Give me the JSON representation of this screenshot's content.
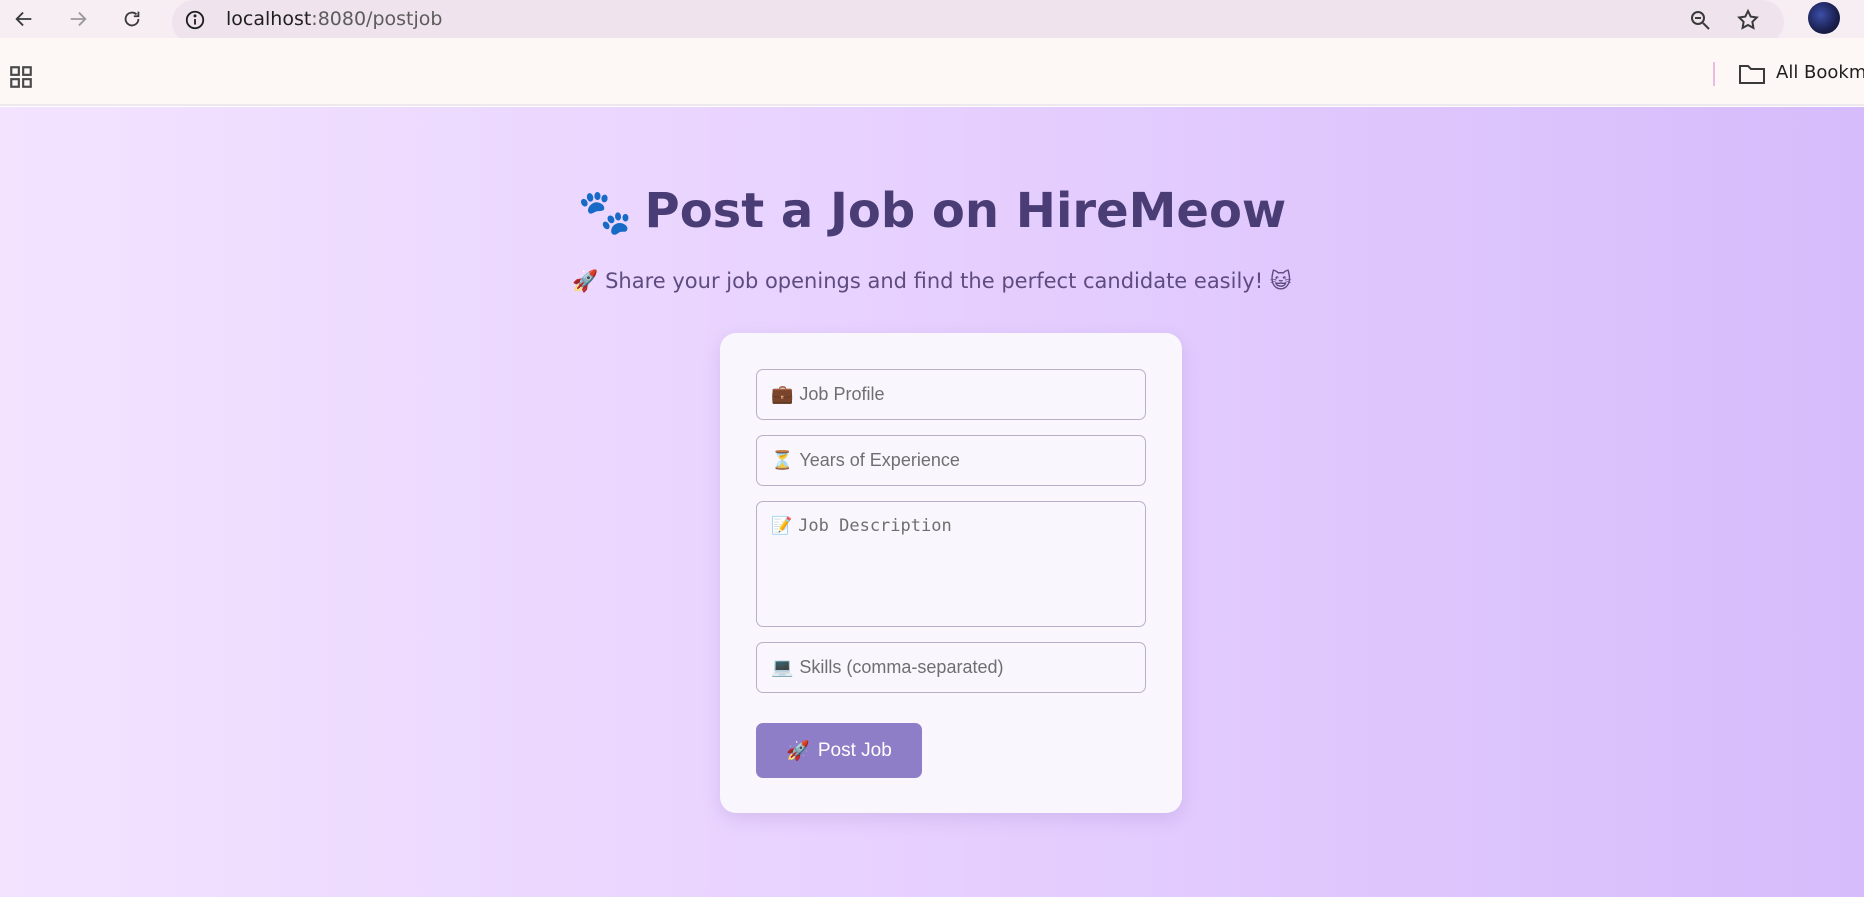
{
  "browser": {
    "url_host": "localhost",
    "url_path": ":8080/postjob",
    "bookmarks_label": "All Bookma"
  },
  "page": {
    "title_emoji": "🐾",
    "title": "Post a Job on HireMeow",
    "subtitle": "🚀 Share your job openings and find the perfect candidate easily! 😺",
    "form": {
      "job_profile_emoji": "💼",
      "job_profile_placeholder": "Job Profile",
      "experience_emoji": "⏳",
      "experience_placeholder": "Years of Experience",
      "description_emoji": "📝",
      "description_placeholder": "Job Description",
      "skills_emoji": "💻",
      "skills_placeholder": "Skills (comma-separated)",
      "submit_emoji": "🚀",
      "submit_label": "Post Job"
    }
  },
  "colors": {
    "title": "#4a3c74",
    "subtitle": "#5e4c80",
    "button": "#8d7ec7",
    "card": "#f9f6fe",
    "gradient_start": "#f3e3ff",
    "gradient_end": "#d6bcfb"
  }
}
